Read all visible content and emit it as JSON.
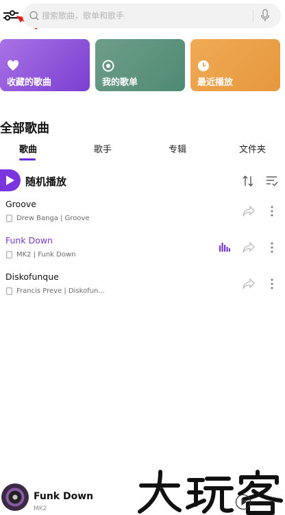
{
  "search": {
    "placeholder": "搜索歌曲，歌单和歌手"
  },
  "cards": [
    {
      "label": "收藏的歌曲",
      "icon": "heart-icon"
    },
    {
      "label": "我的歌单",
      "icon": "disc-icon"
    },
    {
      "label": "最近播放",
      "icon": "clock-icon"
    }
  ],
  "section": {
    "title": "全部歌曲"
  },
  "tabs": [
    "歌曲",
    "歌手",
    "专辑",
    "文件夹"
  ],
  "shuffle": {
    "label": "随机播放"
  },
  "songs": [
    {
      "title": "Groove",
      "subtitle": "Drew Banga | Groove"
    },
    {
      "title": "Funk Down",
      "subtitle": "MK2 | Funk Down"
    },
    {
      "title": "Diskofunque",
      "subtitle": "Francis Preve | Diskofun..."
    }
  ],
  "now_playing": {
    "title": "Funk Down",
    "artist": "MK2"
  },
  "watermark": {
    "text": "大玩家"
  },
  "colors": {
    "accent": "#7a35cf",
    "card1": "#8f55dc",
    "card2": "#5e937e",
    "card3": "#eba048"
  }
}
